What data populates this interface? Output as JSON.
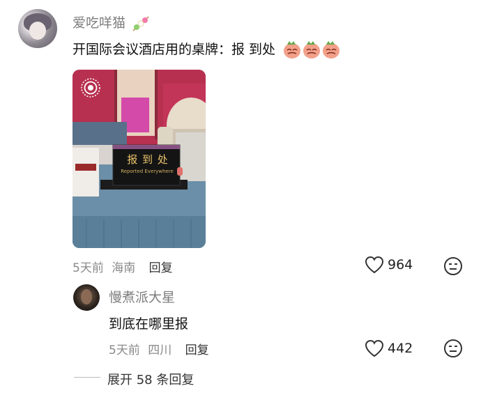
{
  "comment": {
    "username": "爱吃咩猫",
    "text": "开国际会议酒店用的桌牌：报 到处",
    "time": "5天前",
    "location": "海南",
    "reply_label": "回复",
    "likes": "964",
    "photo_sign_text": "报 到 处",
    "photo_sign_subtext": "Reported Everywhere"
  },
  "reply": {
    "username": "慢煮派大星",
    "text": "到底在哪里报",
    "time": "5天前",
    "location": "四川",
    "reply_label": "回复",
    "likes": "442"
  },
  "expand_label": "展开 58 条回复",
  "colors": {
    "muted": "#8a8a8a",
    "text": "#111111",
    "photo_bg": "#5d7f98"
  }
}
